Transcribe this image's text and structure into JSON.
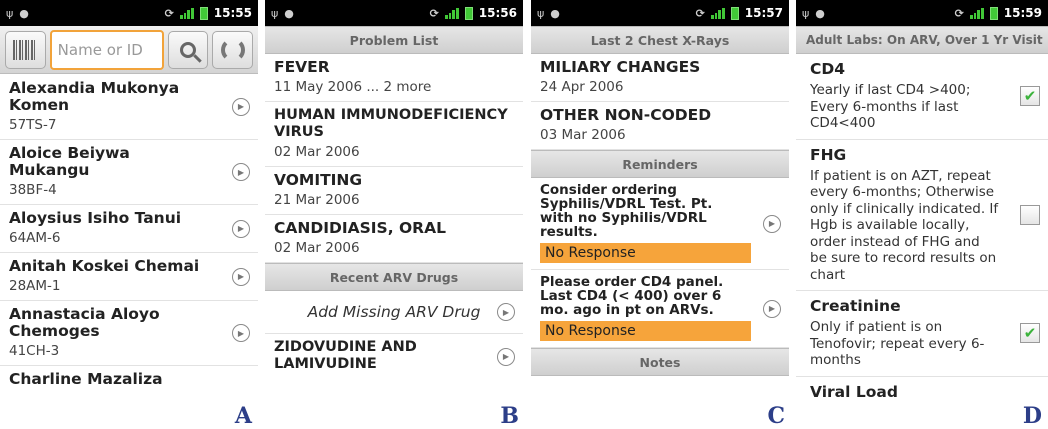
{
  "status": {
    "a_time": "15:55",
    "b_time": "15:56",
    "c_time": "15:57",
    "d_time": "15:59"
  },
  "panel_a": {
    "search_placeholder": "Name or ID",
    "patients": [
      {
        "name": "Alexandia Mukonya Komen",
        "id": "57TS-7"
      },
      {
        "name": "Aloice Beiywa Mukangu",
        "id": "38BF-4"
      },
      {
        "name": "Aloysius Isiho Tanui",
        "id": "64AM-6"
      },
      {
        "name": "Anitah Koskei Chemai",
        "id": "28AM-1"
      },
      {
        "name": "Annastacia Aloyo Chemoges",
        "id": "41CH-3"
      },
      {
        "name": "Charline Mazaliza",
        "id": ""
      }
    ],
    "letter": "A"
  },
  "panel_b": {
    "header_problems": "Problem List",
    "problems": [
      {
        "title": "FEVER",
        "date": "11 May 2006 ... 2 more"
      },
      {
        "title": "HUMAN IMMUNODEFICIENCY VIRUS",
        "date": "02 Mar 2006"
      },
      {
        "title": "VOMITING",
        "date": "21 Mar 2006"
      },
      {
        "title": "CANDIDIASIS, ORAL",
        "date": "02 Mar 2006"
      }
    ],
    "header_drugs": "Recent ARV Drugs",
    "add_drug": "Add Missing ARV Drug",
    "drug": "ZIDOVUDINE AND LAMIVUDINE",
    "letter": "B"
  },
  "panel_c": {
    "header_xray": "Last 2 Chest X-Rays",
    "xrays": [
      {
        "title": "MILIARY CHANGES",
        "date": "24 Apr 2006"
      },
      {
        "title": "OTHER NON-CODED",
        "date": "03 Mar 2006"
      }
    ],
    "header_reminders": "Reminders",
    "reminders": [
      {
        "text": "Consider ordering Syphilis/VDRL Test. Pt. with no Syphilis/VDRL results.",
        "status": "No Response"
      },
      {
        "text": "Please order CD4 panel. Last CD4 (< 400) over 6 mo. ago in pt on ARVs.",
        "status": "No Response"
      }
    ],
    "header_notes": "Notes",
    "letter": "C"
  },
  "panel_d": {
    "header": "Adult Labs: On ARV, Over 1 Yr Visit",
    "labs": [
      {
        "title": "CD4",
        "desc": "Yearly if last CD4 >400; Every 6-months if last CD4<400",
        "checked": true
      },
      {
        "title": "FHG",
        "desc": "If patient is on AZT, repeat every 6-months; Otherwise only if clinically indicated. If Hgb is available locally, order instead of FHG and be sure to record results on chart",
        "checked": false
      },
      {
        "title": "Creatinine",
        "desc": "Only if patient is on Tenofovir; repeat every 6-months",
        "checked": true
      },
      {
        "title": "Viral Load",
        "desc": "",
        "checked": false
      }
    ],
    "letter": "D"
  },
  "icons": {
    "check": "✔",
    "arrow": "▶"
  }
}
